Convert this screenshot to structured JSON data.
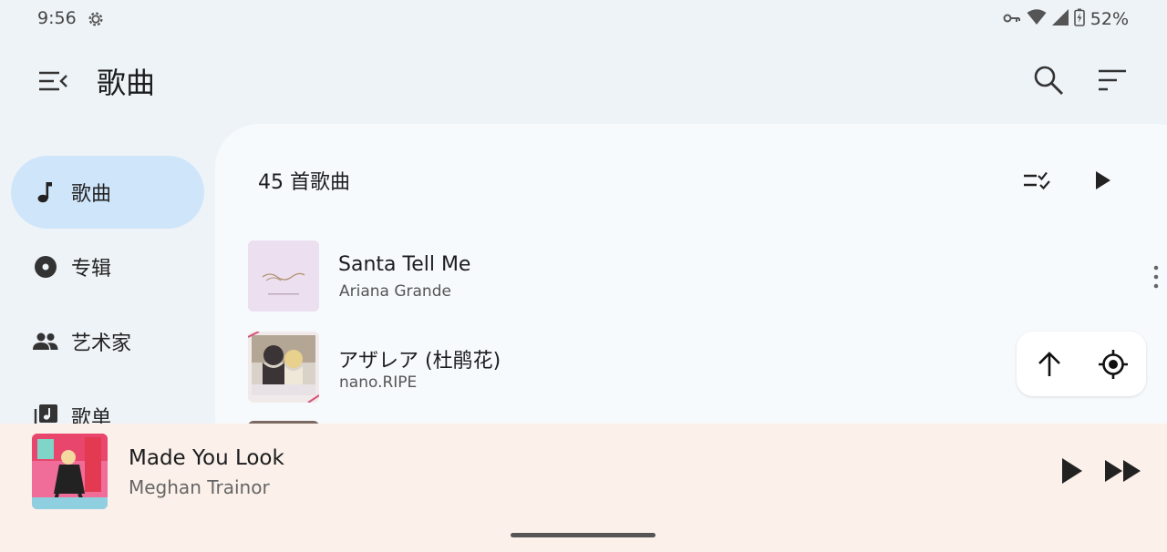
{
  "status_bar": {
    "time": "9:56",
    "battery": "52%",
    "icons": [
      "settings-icon",
      "vpn-key-icon",
      "wifi-icon",
      "cellular-icon",
      "battery-charging-icon"
    ]
  },
  "app_bar": {
    "title": "歌曲",
    "icons": [
      "menu-collapse-icon",
      "search-icon",
      "sort-icon"
    ]
  },
  "nav": {
    "items": [
      {
        "label": "歌曲",
        "icon": "music-note-icon",
        "active": true
      },
      {
        "label": "专辑",
        "icon": "album-icon",
        "active": false
      },
      {
        "label": "艺术家",
        "icon": "people-icon",
        "active": false
      },
      {
        "label": "歌单",
        "icon": "playlist-icon",
        "active": false
      }
    ]
  },
  "content": {
    "song_count": "45 首歌曲",
    "header_icons": [
      "multi-select-icon",
      "play-all-icon"
    ],
    "songs": [
      {
        "title": "Santa Tell Me",
        "artist": "Ariana Grande"
      },
      {
        "title": "アザレア (杜鹃花)",
        "artist": "nano.RIPE"
      }
    ]
  },
  "floating": {
    "icons": [
      "arrow-up-icon",
      "locate-icon"
    ]
  },
  "mini_player": {
    "title": "Made You Look",
    "artist": "Meghan Trainor",
    "icons": [
      "play-icon",
      "skip-next-icon"
    ]
  },
  "colors": {
    "background": "#eef3f8",
    "nav_active": "#cfe5fa",
    "card": "#f7fafc",
    "mini_player": "#fbf0ea"
  }
}
